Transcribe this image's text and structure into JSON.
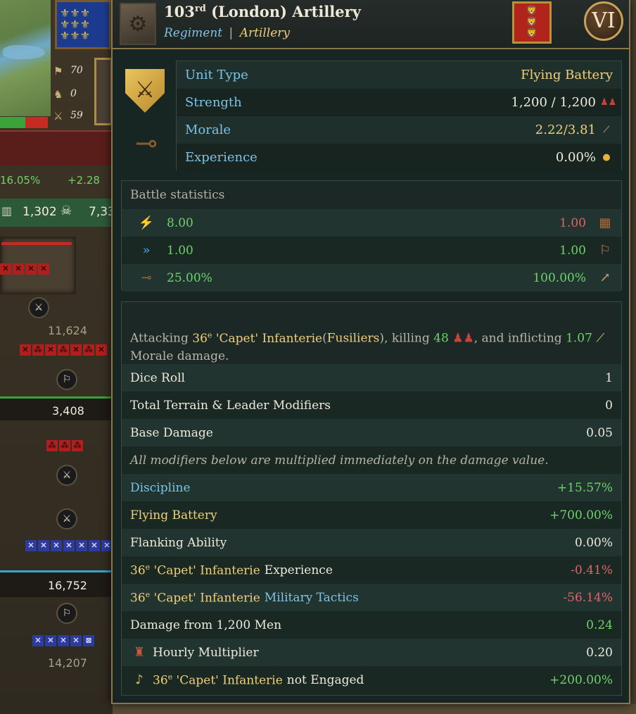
{
  "background": {
    "left_stats": [
      {
        "icon": "flag-icon",
        "value": "70"
      },
      {
        "icon": "horse-icon",
        "value": "0"
      },
      {
        "icon": "crossed-swords-icon",
        "value": "59"
      }
    ],
    "morale_row": {
      "percent": "16.05%",
      "delta": "+2.28"
    },
    "casualties": {
      "value": "1,302",
      "partial": "7,33"
    },
    "counts": [
      "11,624",
      "3,408",
      "16,752",
      "14,207"
    ]
  },
  "tooltip": {
    "header": {
      "number": "103",
      "ordinal": "rd",
      "name": " (London) Artillery",
      "subtitle_type": "Regiment",
      "separator": "|",
      "subtitle_category": "Artillery",
      "rank": "VI"
    },
    "unit_info": {
      "rows": [
        {
          "label": "Unit Type",
          "value": "Flying Battery",
          "value_color": "gold",
          "icon": ""
        },
        {
          "label": "Strength",
          "value": "1,200 / 1,200",
          "value_color": "white",
          "icon": "soldiers-icon"
        },
        {
          "label": "Morale",
          "value": "2.22/3.81",
          "value_color": "gold",
          "icon": "morale-icon"
        },
        {
          "label": "Experience",
          "value": "0.00%",
          "value_color": "white",
          "icon": "medal-icon"
        }
      ]
    },
    "battle_statistics": {
      "title": "Battle statistics",
      "rows": [
        {
          "left_icon": "fire-attack-icon",
          "left_value": "8.00",
          "left_color": "green",
          "right_value": "1.00",
          "right_color": "red",
          "right_icon": "fortification-icon"
        },
        {
          "left_icon": "charge-icon",
          "left_value": "1.00",
          "left_color": "green",
          "right_value": "1.00",
          "right_color": "green",
          "right_icon": "pursuit-icon"
        },
        {
          "left_icon": "artillery-icon",
          "left_value": "25.00%",
          "left_color": "green",
          "right_value": "100.00%",
          "right_color": "green",
          "right_icon": "flanking-icon"
        }
      ]
    },
    "attack": {
      "desc_prefix": "Attacking ",
      "target_num": "36",
      "target_ord": "e",
      "target_name": " 'Capet' Infanterie",
      "paren_open": "(",
      "target_type": "Fusiliers",
      "paren_close": ")",
      "killing_text": ", killing ",
      "killed": "48",
      "inflicting_text": ", and inflicting ",
      "morale_damage": "1.07",
      "desc_suffix": "Morale damage.",
      "rows": [
        {
          "label": "Dice Roll",
          "value": "1"
        },
        {
          "label": "Total Terrain & Leader Modifiers",
          "value": "0"
        },
        {
          "label": "Base Damage",
          "value": "0.05"
        }
      ],
      "note": "All modifiers below are multiplied immediately on the damage value.",
      "modifiers": {
        "discipline": {
          "label": "Discipline",
          "value": "+15.57%"
        },
        "flying_battery": {
          "label": "Flying Battery",
          "value": "+700.00%"
        },
        "flanking": {
          "label": "Flanking Ability",
          "value": "0.00%"
        },
        "experience": {
          "target": "36",
          "ord": "e",
          "name": " 'Capet' Infanterie",
          "suffix": " Experience",
          "value": "-0.41%"
        },
        "tactics": {
          "target": "36",
          "ord": "e",
          "name": " 'Capet' Infanterie",
          "suffix": " Military Tactics",
          "value": "-56.14%"
        },
        "men": {
          "label": "Damage from 1,200 Men",
          "value": "0.24"
        },
        "hourly": {
          "label": "Hourly Multiplier",
          "value": "0.20"
        },
        "not_engaged": {
          "target": "36",
          "ord": "e",
          "name": " 'Capet' Infanterie",
          "suffix": " not Engaged",
          "value": "+200.00%"
        }
      }
    }
  },
  "colors": {
    "blue_label": "#7cc3e6",
    "gold": "#f0cf7a",
    "green": "#6fd36a",
    "red": "#e0646a",
    "panel_bg": "#182623",
    "border": "#8a7649"
  }
}
